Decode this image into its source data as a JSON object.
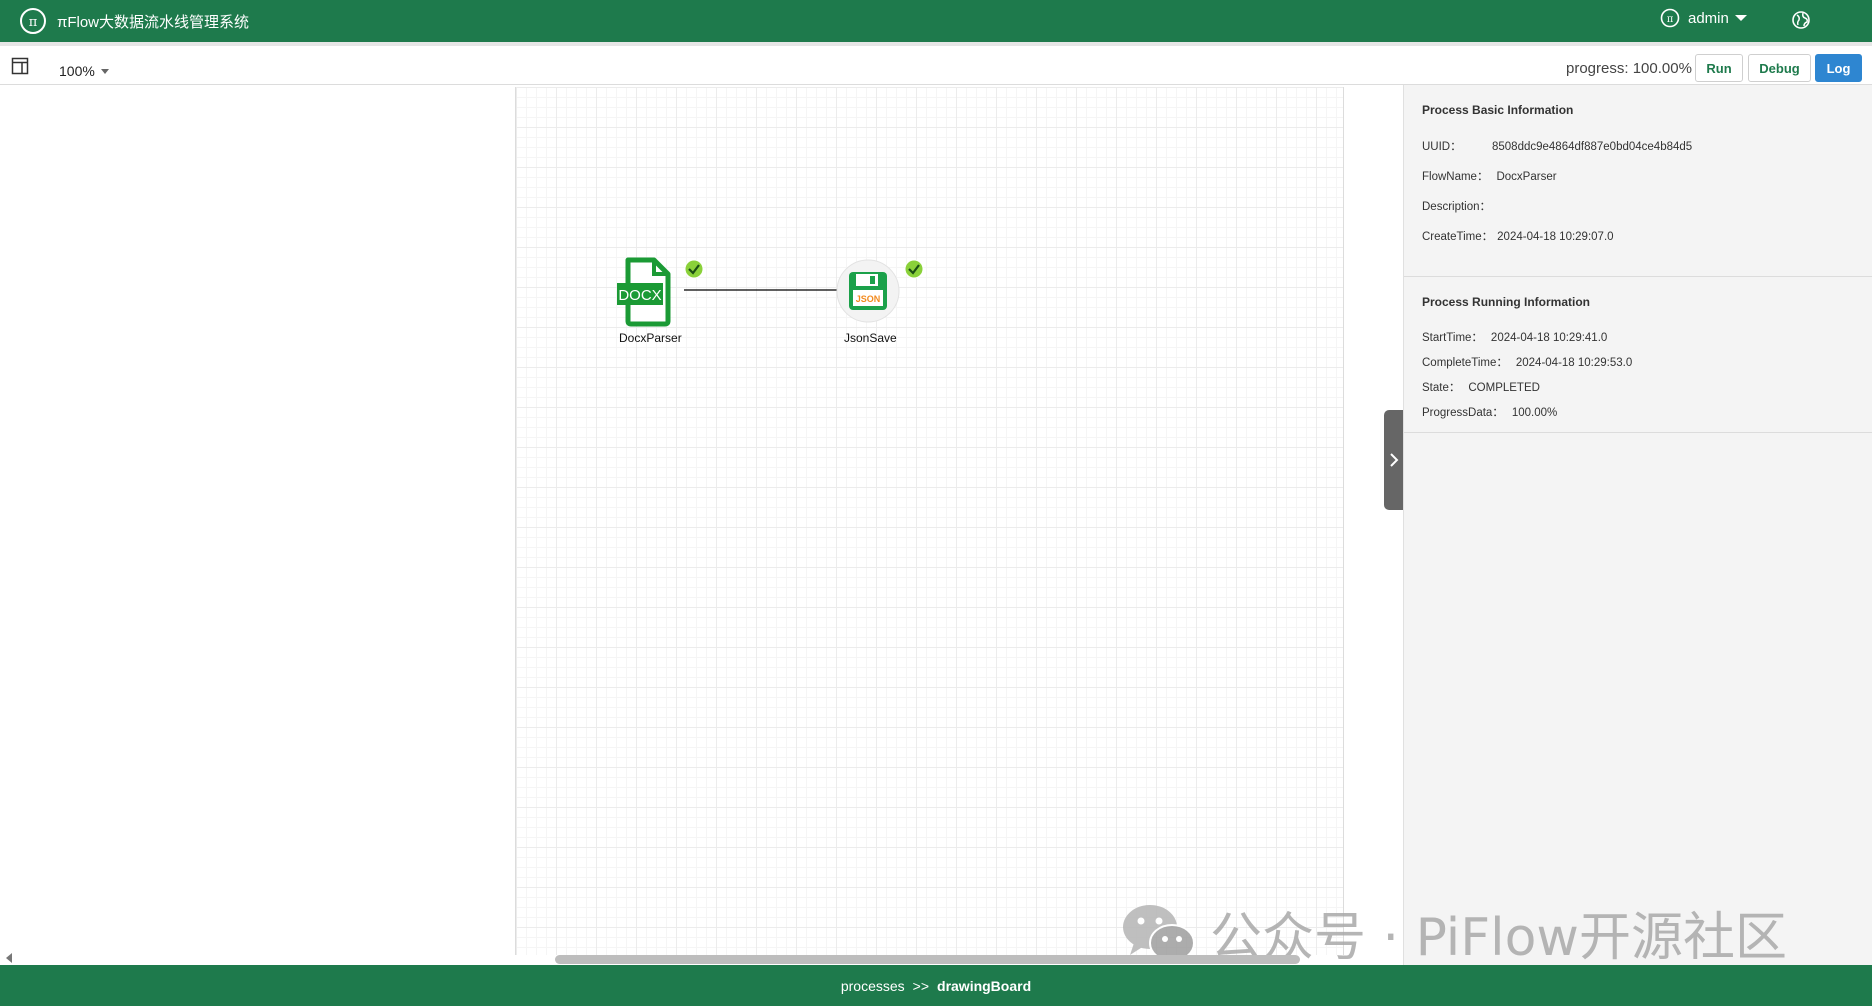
{
  "header": {
    "app_title": "πFlow大数据流水线管理系统",
    "user_name": "admin",
    "brand_color": "#1e7a4c"
  },
  "toolbar": {
    "zoom_level": "100%",
    "progress_label": "progress:",
    "progress_value": "100.00%",
    "run_label": "Run",
    "debug_label": "Debug",
    "log_label": "Log",
    "log_color": "#2e86d1"
  },
  "canvas": {
    "nodes": [
      {
        "label": "DocxParser",
        "icon": "docx-file-icon",
        "status": "success-check-icon"
      },
      {
        "label": "JsonSave",
        "icon": "json-save-icon",
        "status": "success-check-icon"
      }
    ],
    "docx_icon_text": "DOCX",
    "json_icon_text": "JSON"
  },
  "basic_info": {
    "title": "Process Basic Information",
    "uuid_label": "UUID：",
    "uuid_value": "8508ddc9e4864df887e0bd04ce4b84d5",
    "flowname_label": "FlowName：",
    "flowname_value": "DocxParser",
    "description_label": "Description：",
    "description_value": "",
    "createtime_label": "CreateTime：",
    "createtime_value": "2024-04-18 10:29:07.0"
  },
  "running_info": {
    "title": "Process Running Information",
    "starttime_label": "StartTime：",
    "starttime_value": "2024-04-18 10:29:41.0",
    "completetime_label": "CompleteTime：",
    "completetime_value": "2024-04-18 10:29:53.0",
    "state_label": "State：",
    "state_value": "COMPLETED",
    "progressdata_label": "ProgressData：",
    "progressdata_value": "100.00%"
  },
  "watermark": {
    "text": "公众号 · PiFlow开源社区"
  },
  "footer": {
    "crumb_parent": "processes",
    "separator": ">>",
    "crumb_current": "drawingBoard"
  }
}
